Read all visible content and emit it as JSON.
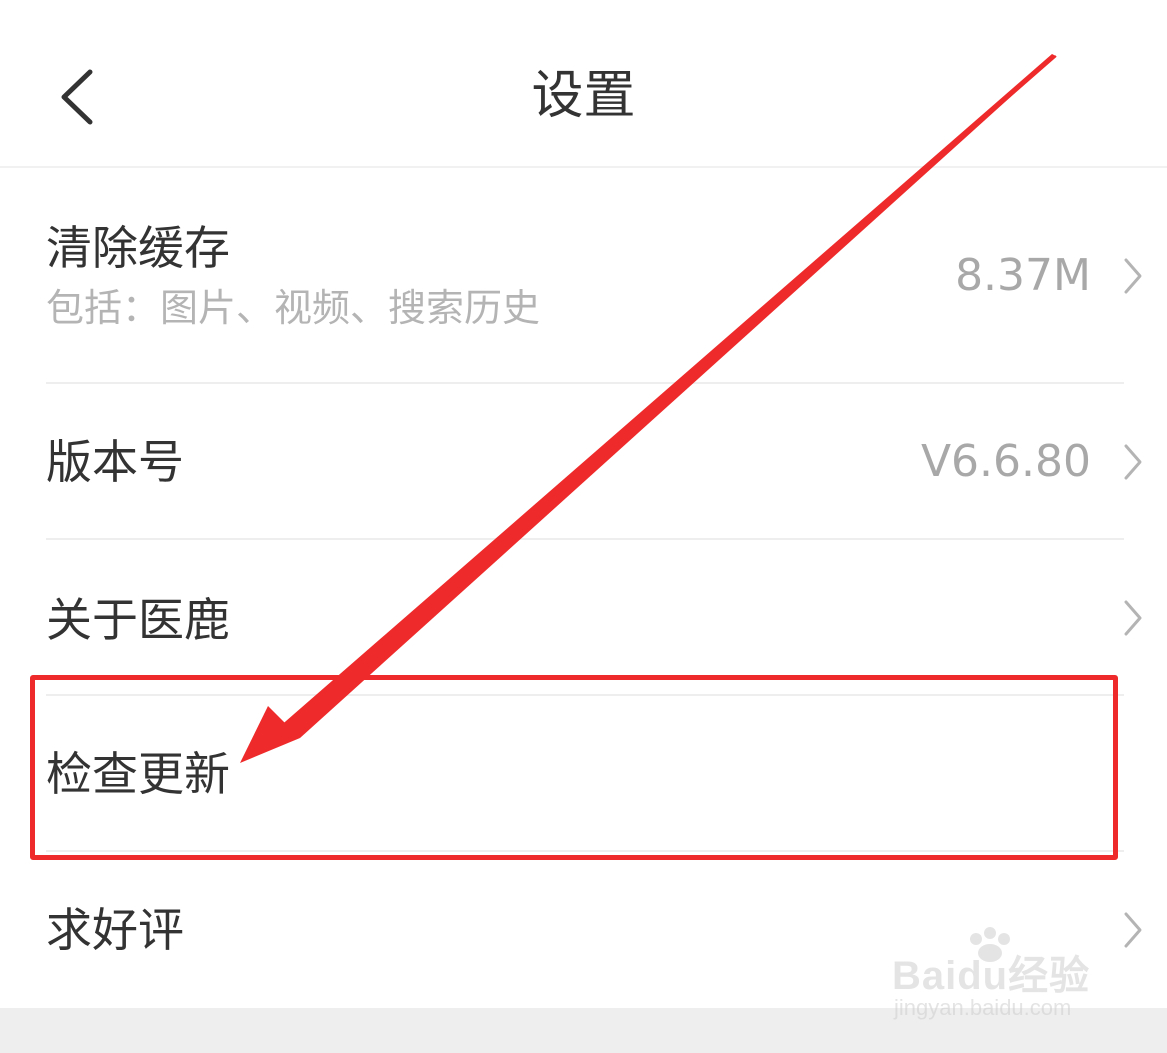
{
  "header": {
    "title": "设置",
    "back_icon": "chevron-left-icon"
  },
  "settings": {
    "items": [
      {
        "label": "清除缓存",
        "sublabel": "包括：图片、视频、搜索历史",
        "value": "8.37M",
        "has_chevron": true
      },
      {
        "label": "版本号",
        "value": "V6.6.80",
        "has_chevron": true
      },
      {
        "label": "关于医鹿",
        "has_chevron": true
      },
      {
        "label": "检查更新",
        "has_chevron": false
      },
      {
        "label": "求好评",
        "has_chevron": true
      }
    ]
  },
  "annotation": {
    "color": "#ee2a2a",
    "highlighted_item": "检查更新"
  },
  "watermark": {
    "logo": "Baidu经验",
    "url": "jingyan.baidu.com"
  },
  "colors": {
    "text_primary": "#333333",
    "text_secondary": "#b4b4b4",
    "value_text": "#a8a8a8",
    "divider": "#eeeeee"
  }
}
